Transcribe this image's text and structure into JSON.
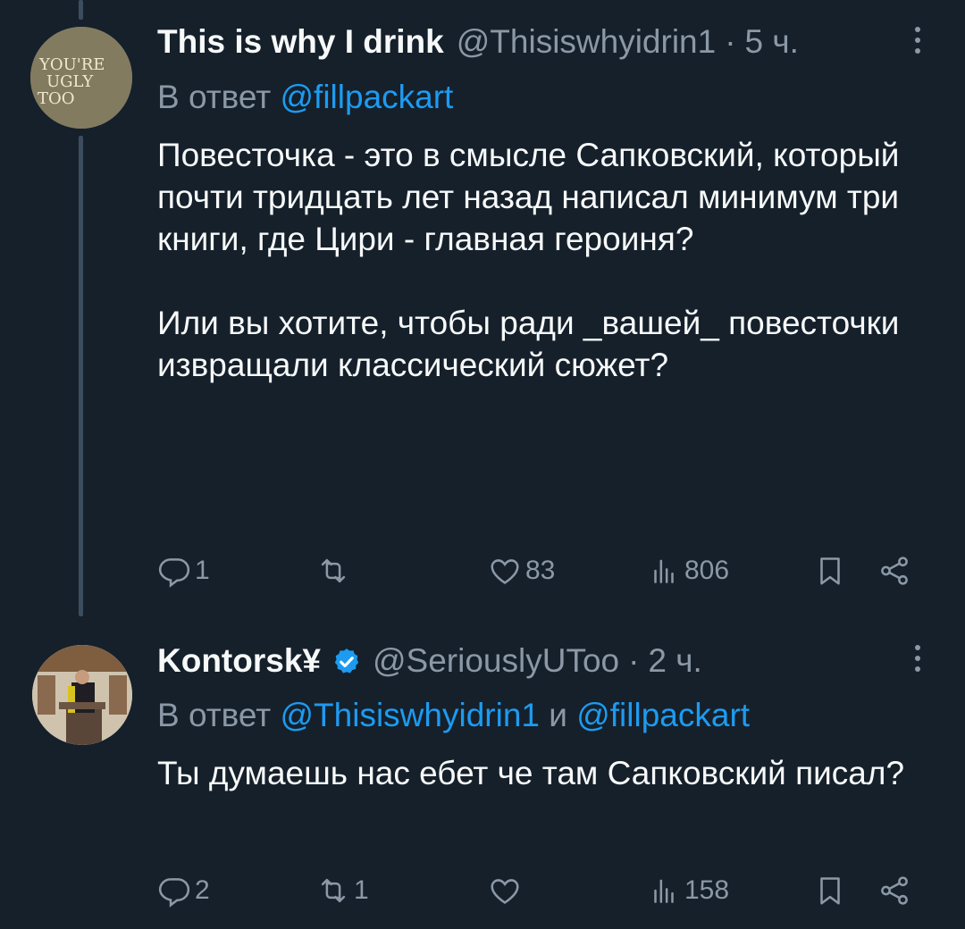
{
  "tweets": [
    {
      "avatar": {
        "text": [
          "YOU'RE",
          "UGLY",
          "TOO"
        ]
      },
      "author": "This is why I drink",
      "handle": "@Thisiswhyidrin1",
      "separator": "·",
      "time": "5 ч.",
      "reply_prefix": "В ответ",
      "reply_to": "@fillpackart",
      "paragraphs": [
        "Повесточка - это в смысле Сапковский, который почти тридцать лет назад написал минимум три книги, где Цири - главная героиня?",
        "Или вы хотите, чтобы ради _вашей_ повесточки извращали классический сюжет?"
      ],
      "counts": {
        "replies": "1",
        "retweets": "",
        "likes": "83",
        "views": "806"
      }
    },
    {
      "author": "Kontorsk¥",
      "verified": true,
      "handle": "@SeriouslyUToo",
      "separator": "·",
      "time": "2 ч.",
      "reply_prefix": "В ответ",
      "reply_to_1": "@Thisiswhyidrin1",
      "reply_joiner": "и",
      "reply_to_2": "@fillpackart",
      "paragraphs": [
        "Ты думаешь нас ебет че там Сапковский писал?"
      ],
      "counts": {
        "replies": "2",
        "retweets": "1",
        "likes": "",
        "views": "158"
      }
    }
  ],
  "colors": {
    "background": "#15202b",
    "text": "#f7f9f9",
    "muted": "#8b98a5",
    "link": "#1d9bf0",
    "thread_line": "#3c4d5e"
  },
  "icons": [
    "reply-icon",
    "retweet-icon",
    "like-icon",
    "views-icon",
    "bookmark-icon",
    "share-icon",
    "more-icon",
    "verified-icon"
  ]
}
